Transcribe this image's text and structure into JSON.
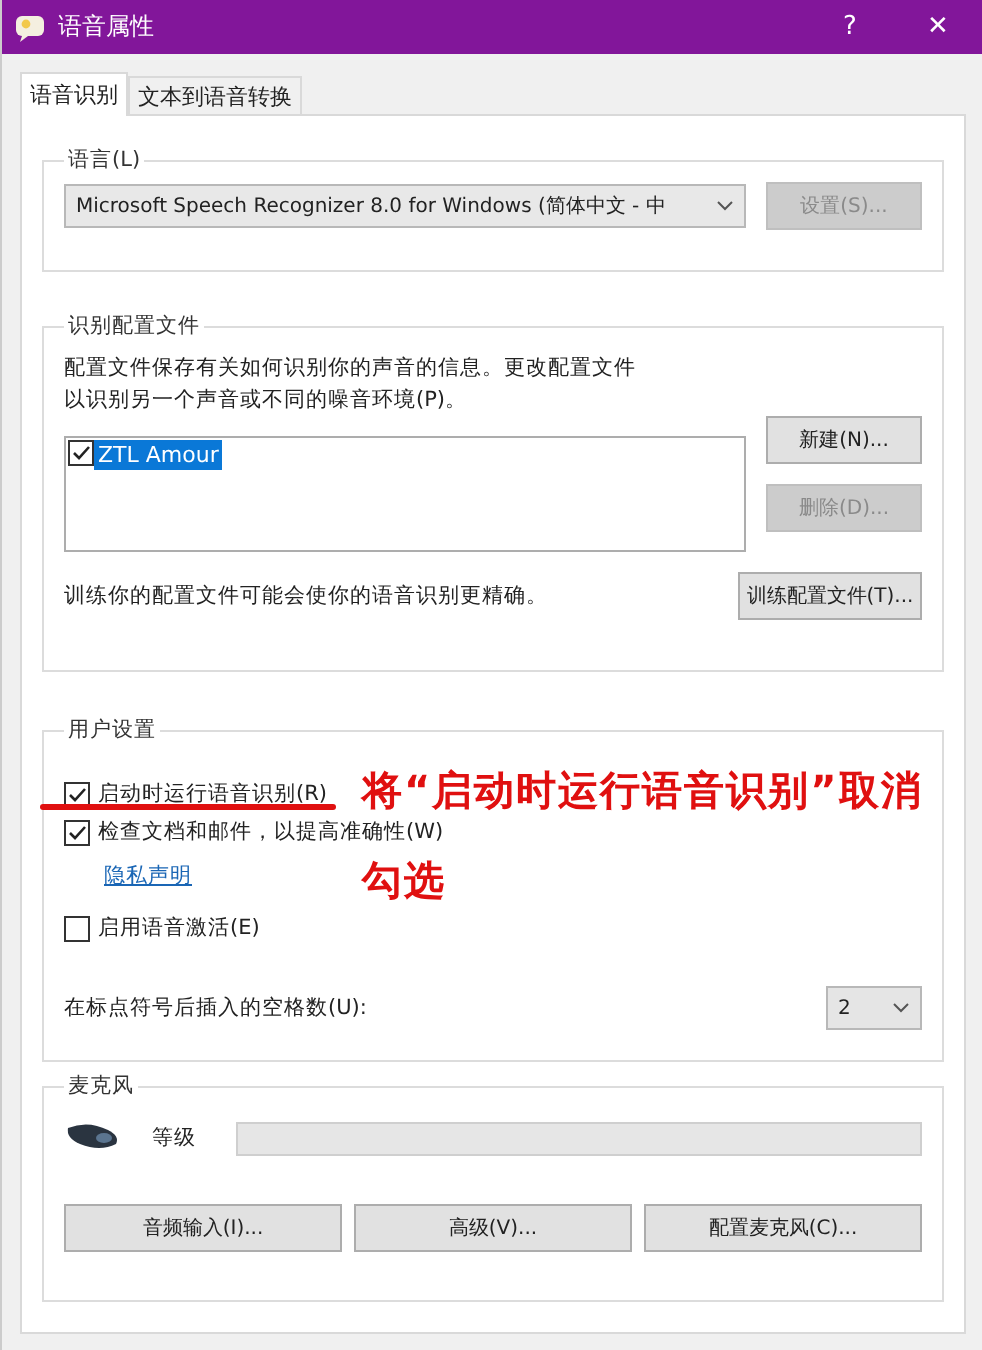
{
  "window": {
    "title": "语音属性",
    "help": "?",
    "close": "✕"
  },
  "tabs": [
    {
      "label": "语音识别",
      "selected": true
    },
    {
      "label": "文本到语音转换",
      "selected": false
    }
  ],
  "language": {
    "title": "语言(L)",
    "value": "Microsoft Speech Recognizer 8.0 for Windows (简体中文 - 中",
    "settings_button": {
      "label": "设置(S)...",
      "disabled": true
    }
  },
  "profiles": {
    "title": "识别配置文件",
    "description": "配置文件保存有关如何识别你的声音的信息。更改配置文件以识别另一个声音或不同的噪音环境(P)。",
    "new_button": {
      "label": "新建(N)...",
      "disabled": false
    },
    "delete_button": {
      "label": "删除(D)...",
      "disabled": true
    },
    "items": [
      {
        "name": "ZTL Amour",
        "checked": true,
        "selected": true
      }
    ],
    "train_hint": "训练你的配置文件可能会使你的语音识别更精确。",
    "train_button": {
      "label": "训练配置文件(T)...",
      "disabled": false
    }
  },
  "user_settings": {
    "title": "用户设置",
    "options": [
      {
        "label": "启动时运行语音识别(R)",
        "checked": true
      },
      {
        "label": "检查文档和邮件，以提高准确性(W)",
        "checked": true
      }
    ],
    "privacy_link": "隐私声明",
    "voice_activation": {
      "label": "启用语音激活(E)",
      "checked": false
    },
    "spaces_label": "在标点符号后插入的空格数(U):",
    "spaces_value": "2"
  },
  "microphone": {
    "title": "麦克风",
    "level_label": "等级",
    "level": 0,
    "buttons": [
      "音频输入(I)...",
      "高级(V)...",
      "配置麦克风(C)..."
    ]
  },
  "annotation": {
    "lines": [
      "将“启动时运行语音识别”取消",
      "勾选"
    ]
  }
}
